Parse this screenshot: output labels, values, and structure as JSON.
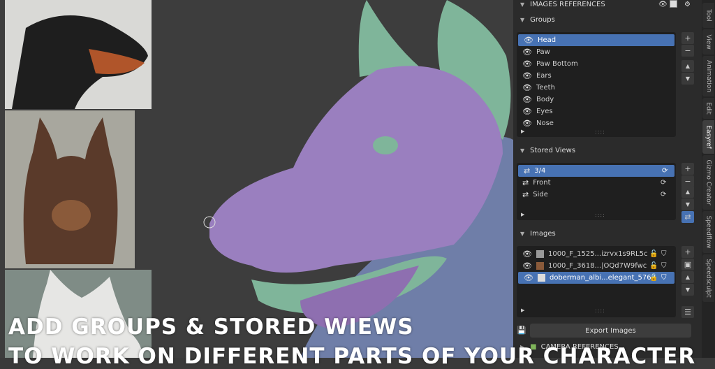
{
  "panel": {
    "top_header": "IMAGES REFERENCES",
    "groups_header": "Groups",
    "groups": [
      {
        "label": "Head",
        "selected": true
      },
      {
        "label": "Paw",
        "selected": false
      },
      {
        "label": "Paw Bottom",
        "selected": false
      },
      {
        "label": "Ears",
        "selected": false
      },
      {
        "label": "Teeth",
        "selected": false
      },
      {
        "label": "Body",
        "selected": false
      },
      {
        "label": "Eyes",
        "selected": false
      },
      {
        "label": "Nose",
        "selected": false
      }
    ],
    "stored_views_header": "Stored Views",
    "stored_views": [
      {
        "label": "3/4",
        "selected": true
      },
      {
        "label": "Front",
        "selected": false
      },
      {
        "label": "Side",
        "selected": false
      }
    ],
    "images_header": "Images",
    "images": [
      {
        "label": "1000_F_1525...izrvx1s9RL5c",
        "selected": false
      },
      {
        "label": "1000_F_3618...|OQd7W9fwc",
        "selected": false
      },
      {
        "label": "doberman_albi...elegant_5768",
        "selected": true
      }
    ],
    "export_label": "Export Images",
    "camera_header": "CAMERA REFERENCES"
  },
  "tabs": [
    "Tool",
    "View",
    "Animation",
    "Edit",
    "Easyref",
    "Gizmo Creator",
    "Speedflow",
    "Speedsculpt"
  ],
  "active_tab": "Easyref",
  "overlay": {
    "line1": "ADD GROUPS & STORED WIEWS",
    "line2": "TO WORK ON DIFFERENT PARTS OF YOUR CHARACTER"
  },
  "colors": {
    "accent": "#4772b3",
    "sculpt_purple": "#9a7fbf",
    "sculpt_green": "#7fb59a"
  },
  "icons": {
    "visibility": "eye-icon",
    "view": "camera-view-icon",
    "refresh": "refresh-icon",
    "lock": "lock-icon",
    "shield": "shield-icon"
  }
}
